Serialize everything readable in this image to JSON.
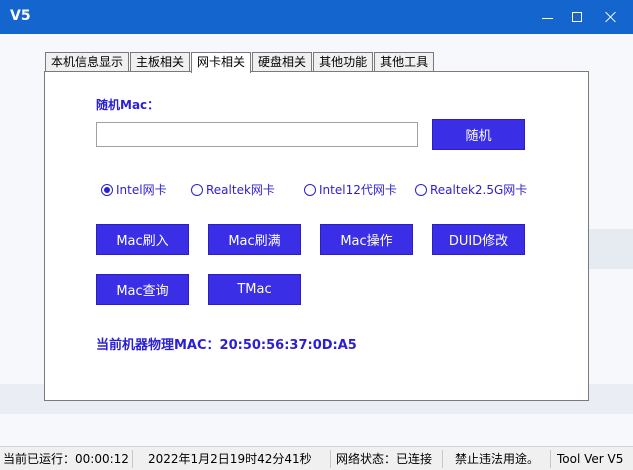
{
  "window": {
    "title": "V5"
  },
  "tabs": [
    {
      "label": "本机信息显示",
      "active": false
    },
    {
      "label": "主板相关",
      "active": false
    },
    {
      "label": "网卡相关",
      "active": true
    },
    {
      "label": "硬盘相关",
      "active": false
    },
    {
      "label": "其他功能",
      "active": false
    },
    {
      "label": "其他工具",
      "active": false
    }
  ],
  "panel": {
    "mac_label": "随机Mac：",
    "mac_input_value": "",
    "random_button": "随机",
    "radios": [
      {
        "label": "Intel网卡",
        "checked": true
      },
      {
        "label": "Realtek网卡",
        "checked": false
      },
      {
        "label": "Intel12代网卡",
        "checked": false
      },
      {
        "label": "Realtek2.5G网卡",
        "checked": false
      }
    ],
    "buttons": {
      "mac_write": "Mac刷入",
      "mac_full": "Mac刷满",
      "mac_operate": "Mac操作",
      "duid_modify": "DUID修改",
      "mac_query": "Mac查询",
      "tmac": "TMac"
    },
    "current_mac": "当前机器物理MAC：20:50:56:37:0D:A5"
  },
  "statusbar": {
    "runtime": "当前已运行：00:00:12",
    "datetime": "2022年1月2日19时42分41秒",
    "network": "网络状态：已连接",
    "notice": "禁止违法用途。",
    "version": "Tool Ver V5"
  },
  "colors": {
    "titlebar": "#1565ce",
    "accent": "#3a2ee6",
    "text_accent": "#2b1fd3"
  }
}
